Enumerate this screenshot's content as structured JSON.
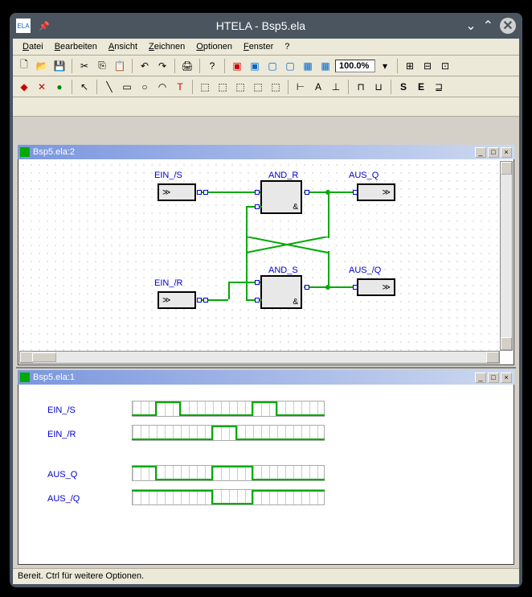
{
  "titlebar": {
    "app_name": "ELA",
    "title": "HTELA - Bsp5.ela"
  },
  "menu": {
    "items": [
      "Datei",
      "Bearbeiten",
      "Ansicht",
      "Zeichnen",
      "Optionen",
      "Fenster",
      "?"
    ]
  },
  "zoom": "100.0%",
  "mdi": {
    "win1_title": "Bsp5.ela:2",
    "win2_title": "Bsp5.ela:1"
  },
  "schematic": {
    "labels": {
      "ein_s": "EIN_/S",
      "ein_r": "EIN_/R",
      "and_r": "AND_R",
      "and_s": "AND_S",
      "aus_q": "AUS_Q",
      "aus_nq": "AUS_/Q"
    }
  },
  "timing": {
    "signals": [
      "EIN_/S",
      "EIN_/R",
      "AUS_Q",
      "AUS_/Q"
    ]
  },
  "statusbar": "Bereit.  Ctrl für weitere Optionen."
}
